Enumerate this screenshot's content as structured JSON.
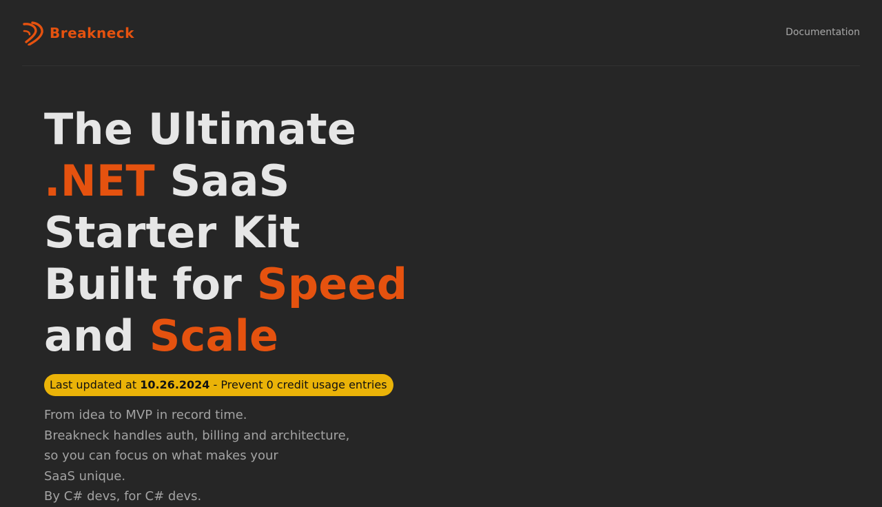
{
  "header": {
    "brand_name": "Breakneck",
    "logo_icon": "breakneck-logo-icon",
    "nav": {
      "documentation_label": "Documentation"
    }
  },
  "hero": {
    "title": {
      "line1": "The Ultimate",
      "line2_accent": ".NET",
      "line2_rest": " SaaS",
      "line3": "Starter Kit",
      "line4_start": "Built for ",
      "line4_accent": "Speed",
      "line5_start": "and ",
      "line5_accent": "Scale"
    },
    "badge": {
      "prefix": "Last updated at ",
      "date": "10.26.2024",
      "suffix": " - Prevent 0 credit usage entries"
    },
    "description": [
      "From idea to MVP in record time.",
      "Breakneck handles auth, billing and architecture,",
      "so you can focus on what makes your",
      "SaaS unique.",
      "By C# devs, for C# devs."
    ]
  },
  "colors": {
    "background": "#262626",
    "accent": "#e5520f",
    "badge": "#eab308",
    "title_text": "#e6e6e6",
    "muted_text": "#a3a3a3"
  }
}
